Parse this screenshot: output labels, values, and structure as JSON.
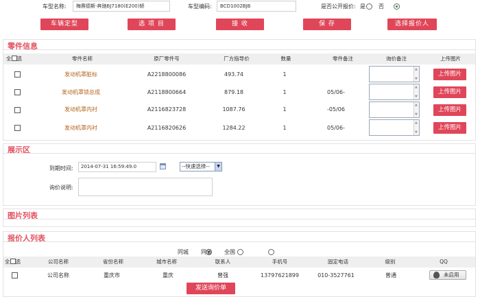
{
  "top": {
    "model_name_label": "车型名称:",
    "model_name_value": "梅赛德斯-奔驰BJ7180(E200)轿",
    "model_code_label": "车型编码:",
    "model_code_value": "BCD1002BJB",
    "public_quote_label": "是否公开报价:",
    "yes_label": "是",
    "no_label": "否",
    "public_quote_selected": "否"
  },
  "toolbar": {
    "vehicle_btn": "车辆定型",
    "select_btn": "选 项 目",
    "receive_btn": "接 收",
    "save_btn": "保 存",
    "select_quoter_btn": "选择报价人"
  },
  "parts": {
    "title": "零件信息",
    "headers": [
      "全选",
      "零件名称",
      "原厂零件号",
      "厂方指导价",
      "数量",
      "零件备注",
      "询价备注",
      "上传图片"
    ],
    "upload_label": "上传图片",
    "rows": [
      {
        "name": "发动机罩脏标",
        "part_no": "A2218800086",
        "price": "493.74",
        "qty": "1",
        "remark": ""
      },
      {
        "name": "发动机罩锁总成",
        "part_no": "A2118800664",
        "price": "879.18",
        "qty": "1",
        "remark": "05/06-"
      },
      {
        "name": "发动机罩内衬",
        "part_no": "A2116823728",
        "price": "1087.76",
        "qty": "1",
        "remark": "-05/06"
      },
      {
        "name": "发动机罩内衬",
        "part_no": "A2116820626",
        "price": "1284.22",
        "qty": "1",
        "remark": "05/06-"
      }
    ]
  },
  "display": {
    "title": "展示区",
    "deadline_label": "到期时间:",
    "deadline_value": "2014-07-31 16:59:49.0",
    "quick_select": "--快速选择--",
    "desc_label": "询价说明:"
  },
  "images": {
    "title": "图片列表"
  },
  "quoters": {
    "title": "报价人列表",
    "scope_options": [
      "同城",
      "同省",
      "全国"
    ],
    "scope_selected": "同城",
    "headers": [
      "全选",
      "公司名称",
      "省份名称",
      "城市名称",
      "联系人",
      "手机号",
      "固定电话",
      "级别",
      "QQ"
    ],
    "rows": [
      {
        "company": "公司名称",
        "province": "重庆市",
        "city": "重庆",
        "contact": "曾强",
        "mobile": "13797621899",
        "phone": "010-3527761",
        "level": "普通",
        "qq": "未启用"
      }
    ],
    "send_btn": "发送询价单"
  },
  "colors": {
    "accent": "#e04659",
    "title": "#e5505f",
    "part_name": "#b4631d",
    "header_bg": "#efefef"
  }
}
